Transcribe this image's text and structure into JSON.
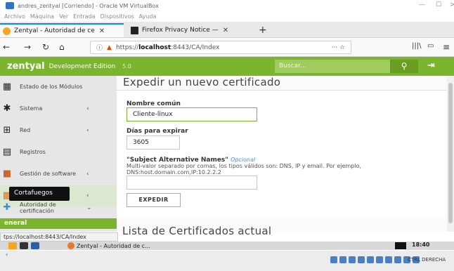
{
  "vbox": {
    "title": "andres_zentyal [Corriendo] - Oracle VM VirtualBox",
    "menu": [
      "Archivo",
      "Máquina",
      "Ver",
      "Entrada",
      "Dispositivos",
      "Ayuda"
    ],
    "host_key": "CTRL DERECHA"
  },
  "browser": {
    "tabs": [
      {
        "label": "Zentyal - Autoridad de ce",
        "active": true
      },
      {
        "label": "Firefox Privacy Notice —",
        "active": false
      }
    ],
    "url": {
      "scheme": "https://",
      "host": "localhost",
      "path": ":8443/CA/Index"
    },
    "status_url": "tps://localhost:8443/CA/Index"
  },
  "header": {
    "brand": "zentyal",
    "edition": "Development Edition",
    "version": "5.0",
    "search_placeholder": "Buscar...",
    "search_icon": "magnifier-icon",
    "logout_icon": "logout-icon"
  },
  "sidebar": {
    "items": [
      {
        "label": "Estado de los Módulos",
        "icon": "modules-status-icon",
        "chevron": ""
      },
      {
        "label": "Sistema",
        "icon": "gear-icon",
        "chevron": "‹"
      },
      {
        "label": "Red",
        "icon": "network-icon",
        "chevron": "‹"
      },
      {
        "label": "Registros",
        "icon": "logs-icon",
        "chevron": ""
      },
      {
        "label": "Gestión de software",
        "icon": "package-icon",
        "chevron": "‹"
      },
      {
        "label": "Cortafuegos",
        "icon": "firewall-icon",
        "chevron": "‹"
      },
      {
        "label": "Autoridad de certificación",
        "icon": "certificate-icon",
        "chevron": "⌄"
      }
    ],
    "tooltip": "Cortafuegos",
    "section_general": "eneral"
  },
  "form": {
    "title": "Expedir un nuevo certificado",
    "common_name_label": "Nombre común",
    "common_name_value": "Cliente-linux",
    "days_label": "Días para expirar",
    "days_value": "3605",
    "san_label": "\"Subject Alternative Names\"",
    "san_optional": "Opcional",
    "san_hint_line1": "Multi-valor separado por comas, los tipos válidos son: DNS, IP y email. Por ejemplo,",
    "san_hint_line2": "DNS:host.domain.com,IP:10.2.2.2",
    "san_value": "",
    "submit_label": "EXPEDIR"
  },
  "list": {
    "title": "Lista de Certificados actual"
  },
  "taskbar": {
    "app_label": "Zentyal - Autoridad de c...",
    "time": "18:40"
  },
  "colors": {
    "zentyal_green": "#7bb52e",
    "firefox_blue": "#0a84ff"
  }
}
